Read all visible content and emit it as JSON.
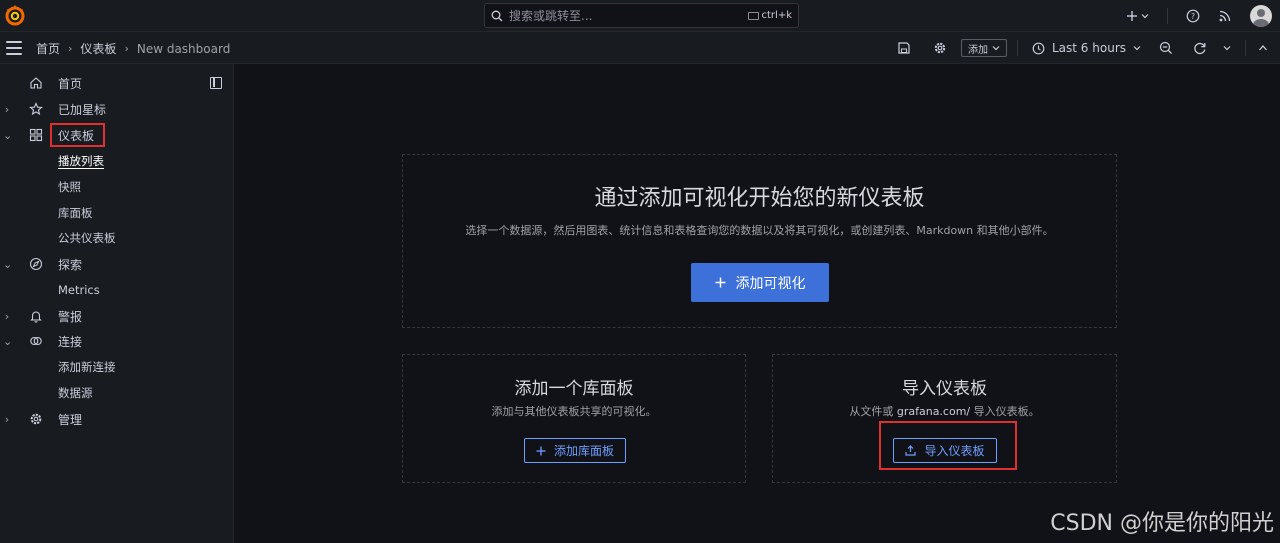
{
  "topbar": {
    "search_placeholder": "搜索或跳转至...",
    "search_shortcut": "ctrl+k",
    "icons": [
      "grafana-logo",
      "plus-icon",
      "help-icon",
      "news-rss-icon",
      "user-avatar"
    ]
  },
  "navbar": {
    "breadcrumb": [
      "首页",
      "仪表板",
      "New dashboard"
    ],
    "add_label": "添加",
    "time_range": "Last 6 hours",
    "icons": [
      "save-icon",
      "settings-icon",
      "clock-icon",
      "zoom-out-icon",
      "refresh-icon"
    ]
  },
  "sidebar": {
    "items": [
      {
        "label": "首页",
        "icon": "home-icon",
        "expand": "none"
      },
      {
        "label": "已加星标",
        "icon": "star-icon",
        "expand": "collapsed"
      },
      {
        "label": "仪表板",
        "icon": "apps-icon",
        "expand": "expanded",
        "highlighted": true
      },
      {
        "label": "播放列表",
        "sub": true,
        "active": true
      },
      {
        "label": "快照",
        "sub": true
      },
      {
        "label": "库面板",
        "sub": true
      },
      {
        "label": "公共仪表板",
        "sub": true
      },
      {
        "label": "探索",
        "icon": "compass-icon",
        "expand": "expanded"
      },
      {
        "label": "Metrics",
        "sub": true
      },
      {
        "label": "警报",
        "icon": "bell-icon",
        "expand": "collapsed"
      },
      {
        "label": "连接",
        "icon": "link-icon",
        "expand": "expanded"
      },
      {
        "label": "添加新连接",
        "sub": true
      },
      {
        "label": "数据源",
        "sub": true
      },
      {
        "label": "管理",
        "icon": "cog-icon",
        "expand": "collapsed"
      }
    ]
  },
  "main": {
    "hero": {
      "title": "通过添加可视化开始您的新仪表板",
      "subtitle": "选择一个数据源，然后用图表、统计信息和表格查询您的数据以及将其可视化，或创建列表、Markdown 和其他小部件。",
      "button": "添加可视化"
    },
    "library_card": {
      "title": "添加一个库面板",
      "subtitle": "添加与其他仪表板共享的可视化。",
      "button": "添加库面板"
    },
    "import_card": {
      "title": "导入仪表板",
      "subtitle_pre": "从文件或",
      "subtitle_link": "grafana.com/",
      "subtitle_post": "导入仪表板。",
      "button": "导入仪表板",
      "highlighted": true
    }
  },
  "watermark": "CSDN @你是你的阳光",
  "colors": {
    "background": "#111217",
    "panel": "#181b1f",
    "primary": "#3d71d9",
    "link": "#6e9fff",
    "highlight": "#e02f2f",
    "logo_orange": "#f46800"
  }
}
